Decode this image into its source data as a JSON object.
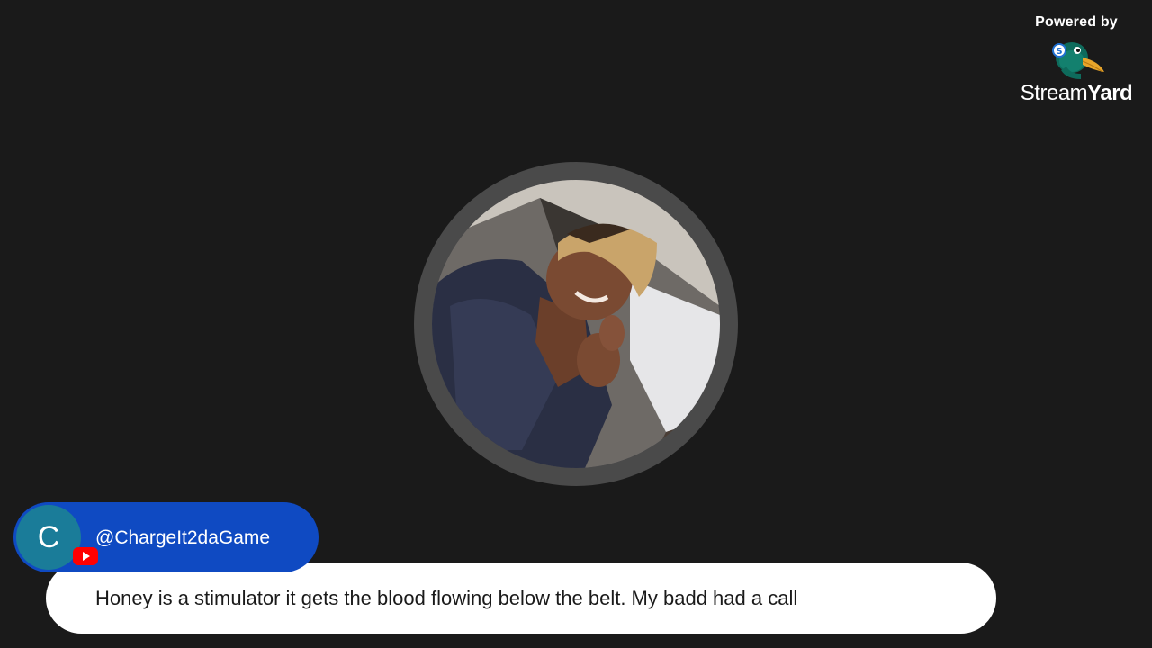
{
  "branding": {
    "powered_by": "Powered by",
    "wordmark_regular": "Stream",
    "wordmark_bold": "Yard",
    "logo_icon": "streamyard-duck-logo"
  },
  "presenter": {
    "avatar_icon": "presenter-photo"
  },
  "comment": {
    "author_initial": "C",
    "author_handle": "@ChargeIt2daGame",
    "platform_icon": "youtube-icon",
    "text": "Honey is a stimulator it gets the blood flowing below the belt. My badd had a call"
  },
  "colors": {
    "background": "#1a1a1a",
    "avatar_ring": "#4a4a4a",
    "author_pill": "#0f4ac2",
    "author_avatar": "#1a7c99",
    "bubble": "#ffffff",
    "youtube_red": "#ff0000"
  }
}
